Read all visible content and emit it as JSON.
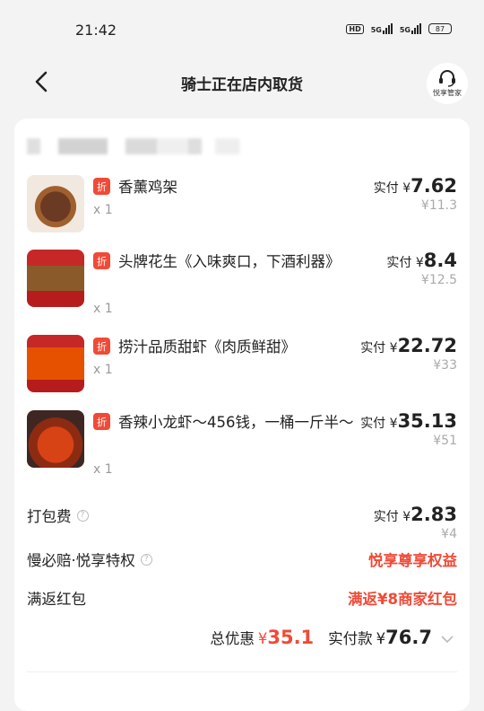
{
  "status": {
    "time": "21:42",
    "hd": "HD",
    "net1": "5G",
    "net2": "5G",
    "battery": "87"
  },
  "nav": {
    "title": "骑士正在店内取货",
    "butler_label": "悦享管家"
  },
  "items": [
    {
      "name": "香薰鸡架",
      "badge": "折",
      "qty": "x 1",
      "paid_label": "实付",
      "yen": "¥",
      "price": "7.62",
      "orig": "¥11.3"
    },
    {
      "name": "头牌花生《入味爽口，下酒利器》",
      "badge": "折",
      "qty": "x 1",
      "paid_label": "实付",
      "yen": "¥",
      "price": "8.4",
      "orig": "¥12.5"
    },
    {
      "name": "捞汁品质甜虾《肉质鲜甜》",
      "badge": "折",
      "qty": "x 1",
      "paid_label": "实付",
      "yen": "¥",
      "price": "22.72",
      "orig": "¥33"
    },
    {
      "name": "香辣小龙虾～456钱，一桶一斤半～",
      "badge": "折",
      "qty": "x 1",
      "paid_label": "实付",
      "yen": "¥",
      "price": "35.13",
      "orig": "¥51"
    }
  ],
  "packing": {
    "label": "打包费",
    "paid_label": "实付",
    "yen": "¥",
    "price": "2.83",
    "orig": "¥4"
  },
  "privilege": {
    "label": "慢必赔·悦享特权",
    "value": "悦享尊享权益"
  },
  "redpacket": {
    "label": "满返红包",
    "value": "满返¥8商家红包"
  },
  "total": {
    "discount_label": "总优惠",
    "discount_yen": "¥",
    "discount": "35.1",
    "paid_label": "实付款",
    "paid_yen": "¥",
    "paid": "76.7"
  },
  "colors": {
    "accent": "#f04a37",
    "background": "#f3f3f3"
  }
}
